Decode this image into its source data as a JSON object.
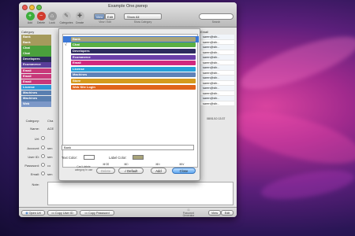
{
  "window": {
    "title": "Example One.pwrep",
    "toolbar": {
      "buttons": [
        {
          "label": "Add",
          "color": "#3cae3c",
          "glyph": "+"
        },
        {
          "label": "Delete",
          "color": "#d23a2e",
          "glyph": "−"
        },
        {
          "label": "Lock",
          "color": "#9a9a9a",
          "glyph": "⌂"
        },
        {
          "label": "Categories",
          "color": "#c0c0c0",
          "glyph": "✎"
        },
        {
          "label": "Create",
          "color": "#bcbcbc",
          "glyph": "✚"
        },
        {
          "label": "View / Edit",
          "color": "#c8c8c8",
          "glyph": "◫"
        }
      ],
      "view_label": "View",
      "edit_label": "Edit",
      "show_category": "Show All",
      "show_category_label": "Show Category",
      "search_label": "Search"
    },
    "category_header": "Category",
    "categories": [
      {
        "label": "Bank",
        "color": "#a59a5c"
      },
      {
        "label": "Bank",
        "color": "#a59a5c"
      },
      {
        "label": "Chat",
        "color": "#4aa03c"
      },
      {
        "label": "Chat",
        "color": "#4aa03c"
      },
      {
        "label": "Developers",
        "color": "#2c2c5c"
      },
      {
        "label": "Ecommerce",
        "color": "#5a3e9a"
      },
      {
        "label": "Email",
        "color": "#c8387a"
      },
      {
        "label": "Email",
        "color": "#c8387a"
      },
      {
        "label": "Email",
        "color": "#c8387a"
      },
      {
        "label": "License",
        "color": "#2f96d6"
      },
      {
        "label": "Machines",
        "color": "#5a7fb0"
      },
      {
        "label": "Machines",
        "color": "#5a7fb0"
      },
      {
        "label": "Web",
        "color": "#7c98c8"
      }
    ],
    "list_header": "Email",
    "list_rows": [
      "saren@stir...",
      "saren@stir...",
      "saren@stir...",
      "saren@stir...",
      "saren@stir...",
      "saren@stir...",
      "saren@stir...",
      "saren@stir...",
      "saren@stir...",
      "saren@stir...",
      "saren@stir...",
      "saren@stir...",
      "saren@stir...",
      "saren@stir..."
    ],
    "modified_stamp": "08/01/10 13:37",
    "form": {
      "category_label": "Category:",
      "category_value": "Cha",
      "name_label": "Name:",
      "name_value": "ACE",
      "url_label": "Url:",
      "account_label": "Account:",
      "account_value": "sen",
      "user_id_label": "User ID:",
      "user_id_value": "sen",
      "password_label": "Password:",
      "password_value": "•••",
      "email_label": "Email:",
      "email_value": "sen",
      "note_label": "Note:"
    },
    "bottom": {
      "open_url": "Open Url",
      "copy_user_id": "Copy User ID",
      "copy_password": "Copy Password",
      "password_generator": "Password Generator",
      "view": "View",
      "edit": "Edit"
    }
  },
  "sheet": {
    "categories": [
      {
        "label": "Bank",
        "color": "#a9a47a",
        "checked": false
      },
      {
        "label": "Chat",
        "color": "#5ab043",
        "checked": true
      },
      {
        "label": "Developers",
        "color": "#2d2b5e",
        "checked": false
      },
      {
        "label": "Ecommerce",
        "color": "#6a3ea8",
        "checked": false
      },
      {
        "label": "Email",
        "color": "#d0297e",
        "checked": false
      },
      {
        "label": "License",
        "color": "#27a0d8",
        "checked": false
      },
      {
        "label": "Machines",
        "color": "#5f83b8",
        "checked": false
      },
      {
        "label": "Store",
        "color": "#d49a1e",
        "checked": false
      },
      {
        "label": "Web Site Login",
        "color": "#e0641c",
        "checked": false
      }
    ],
    "name_value": "Bank",
    "text_color_label": "Text Color:",
    "text_color": "#ffffff",
    "label_color_label": "Label Color:",
    "label_color": "#a9a47a",
    "cant_delete_note": "Can't delete category in use",
    "delete_label": "Delete",
    "default_label": "√ Default",
    "add_label": "Add",
    "close_label": "Close",
    "shortcut_delete": "⌘⌫",
    "shortcut_default": "⌘D",
    "shortcut_add": "⌘N",
    "shortcut_close": "⌘W"
  }
}
